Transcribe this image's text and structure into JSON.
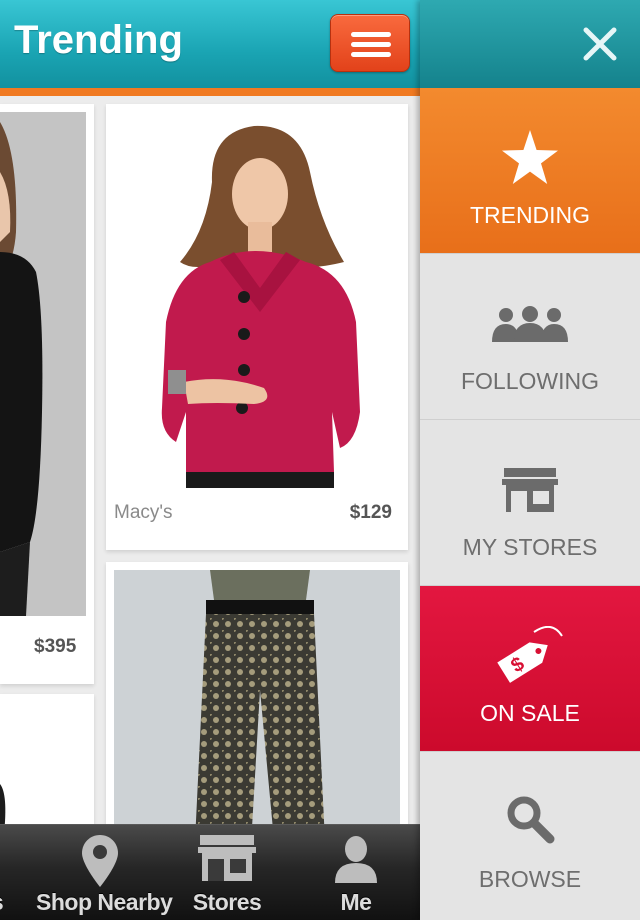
{
  "header": {
    "title": "Trending"
  },
  "colors": {
    "header_teal": "#1aa4b3",
    "accent_orange": "#f07a22",
    "menu_button": "#e2421a",
    "sale_red": "#d80f33",
    "tabbar_dark": "#1e1e1e"
  },
  "feed": {
    "items": [
      {
        "store": "",
        "price": "$395"
      },
      {
        "store": "Macy's",
        "price": "$129"
      },
      {
        "store": "",
        "price": ""
      },
      {
        "store": "",
        "price": ""
      }
    ]
  },
  "tabbar": {
    "tabs": [
      {
        "label": "s",
        "icon": "partial-tab-icon"
      },
      {
        "label": "Shop Nearby",
        "icon": "map-pin-icon"
      },
      {
        "label": "Stores",
        "icon": "storefront-icon"
      },
      {
        "label": "Me",
        "icon": "person-icon"
      }
    ]
  },
  "side_menu": {
    "close_icon": "close-icon",
    "items": [
      {
        "label": "TRENDING",
        "icon": "star-icon",
        "state": "selected"
      },
      {
        "label": "FOLLOWING",
        "icon": "people-icon",
        "state": "normal"
      },
      {
        "label": "MY STORES",
        "icon": "storefront-icon",
        "state": "normal"
      },
      {
        "label": "ON SALE",
        "icon": "price-tag-icon",
        "state": "highlight"
      },
      {
        "label": "BROWSE",
        "icon": "search-icon",
        "state": "normal"
      }
    ]
  }
}
